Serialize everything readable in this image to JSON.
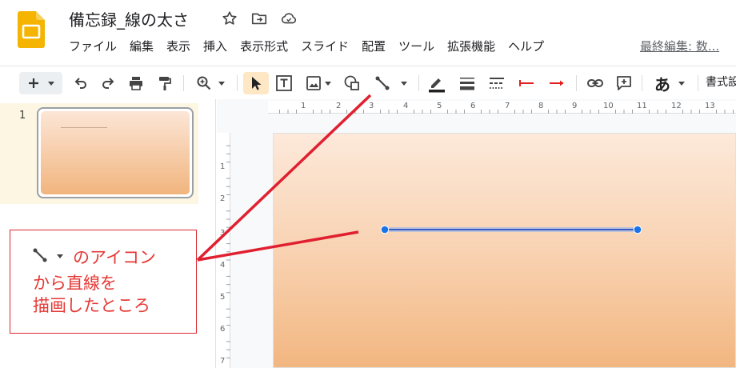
{
  "app": {
    "icon": "google-slides-logo",
    "title": "備忘録_線の太さ",
    "title_icons": [
      "star-icon",
      "move-to-folder-icon",
      "cloud-status-icon"
    ]
  },
  "menu": {
    "items": [
      "ファイル",
      "編集",
      "表示",
      "挿入",
      "表示形式",
      "スライド",
      "配置",
      "ツール",
      "拡張機能",
      "ヘルプ"
    ],
    "last_edit": "最終編集: 数..."
  },
  "toolbar": {
    "icons": [
      "new-slide-icon",
      "undo-icon",
      "redo-icon",
      "print-icon",
      "paint-format-icon",
      "zoom-icon",
      "select-icon",
      "text-box-icon",
      "image-icon",
      "shape-icon",
      "line-icon",
      "line-color-icon",
      "line-weight-icon",
      "line-dash-icon",
      "line-start-icon",
      "line-end-icon",
      "link-icon",
      "comment-icon",
      "input-tools-icon"
    ],
    "input_tools_label": "あ",
    "format_options": "書式設"
  },
  "filmstrip": {
    "slides": [
      {
        "number": "1"
      }
    ]
  },
  "rulers": {
    "horizontal": [
      "1",
      "2",
      "3",
      "4",
      "5",
      "6",
      "7",
      "8",
      "9",
      "10",
      "11",
      "12",
      "13"
    ],
    "vertical": [
      "1",
      "2",
      "3",
      "4",
      "5",
      "6",
      "7"
    ]
  },
  "annotation": {
    "line1": "のアイコン",
    "line2": "から直線を",
    "line3": "描画したところ",
    "color": "#e53935"
  },
  "colors": {
    "accent": "#f4b400",
    "selected_tool_bg": "#fde7c4",
    "line_handle": "#1a73e8",
    "arrow": "#e02030"
  }
}
